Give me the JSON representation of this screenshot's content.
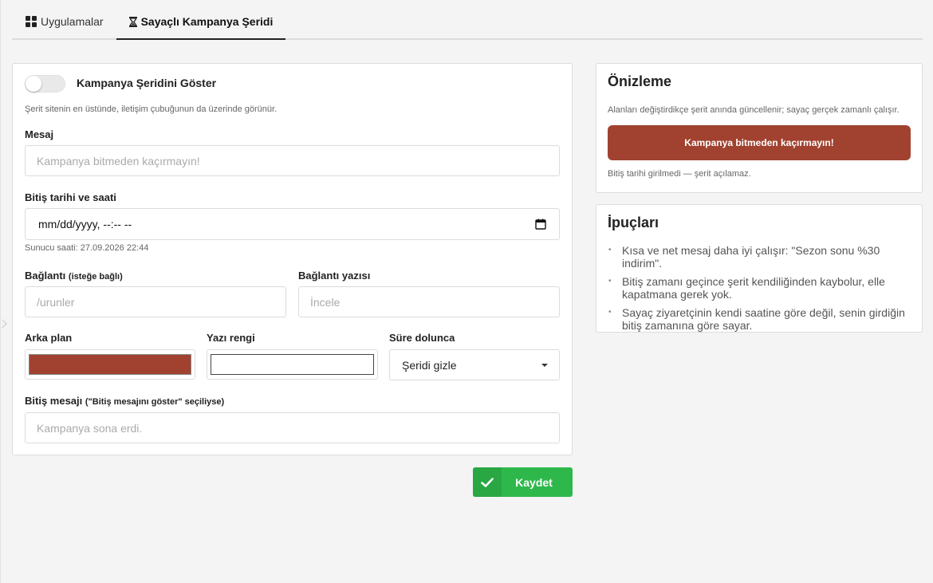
{
  "tabs": [
    {
      "label": "Uygulamalar",
      "icon": "grid-icon",
      "active": false
    },
    {
      "label": "Sayaçlı Kampanya Şeridi",
      "icon": "hourglass-icon",
      "active": true
    }
  ],
  "form": {
    "toggle_label": "Kampanya Şeridini Göster",
    "toggle_on": false,
    "toggle_help": "Şerit sitenin en üstünde, iletişim çubuğunun da üzerinde görünür.",
    "message_label": "Mesaj",
    "message_placeholder": "Kampanya bitmeden kaçırmayın!",
    "message_value": "",
    "end_label": "Bitiş tarihi ve saati",
    "end_value": "mm/dd/yyyy, --:-- --",
    "server_time": "Sunucu saati: 27.09.2026 22:44",
    "link_label": "Bağlantı",
    "link_label_hint": "(isteğe bağlı)",
    "link_placeholder": "/urunler",
    "link_text_label": "Bağlantı yazısı",
    "link_text_placeholder": "İncele",
    "bg_label": "Arka plan",
    "bg_color": "#a14230",
    "text_color_label": "Yazı rengi",
    "text_color": "#ffffff",
    "on_expire_label": "Süre dolunca",
    "on_expire_value": "Şeridi gizle",
    "end_message_label": "Bitiş mesajı",
    "end_message_hint": "(\"Bitiş mesajını göster\" seçiliyse)",
    "end_message_placeholder": "Kampanya sona erdi.",
    "save_label": "Kaydet"
  },
  "preview": {
    "title": "Önizleme",
    "note": "Alanları değiştirdikçe şerit anında güncellenir; sayaç gerçek zamanlı çalışır.",
    "banner_text": "Kampanya bitmeden kaçırmayın!",
    "banner_bg": "#a14230",
    "banner_fg": "#ffffff",
    "status": "Bitiş tarihi girilmedi — şerit açılamaz."
  },
  "tips": {
    "title": "İpuçları",
    "items": [
      "Kısa ve net mesaj daha iyi çalışır: \"Sezon sonu %30 indirim\".",
      "Bitiş zamanı geçince şerit kendiliğinden kaybolur, elle kapatmana gerek yok.",
      "Sayaç ziyaretçinin kendi saatine göre değil, senin girdiğin bitiş zamanına göre sayar."
    ]
  },
  "colors": {
    "accent_green": "#2eb84b",
    "border": "#dcdcdc"
  }
}
